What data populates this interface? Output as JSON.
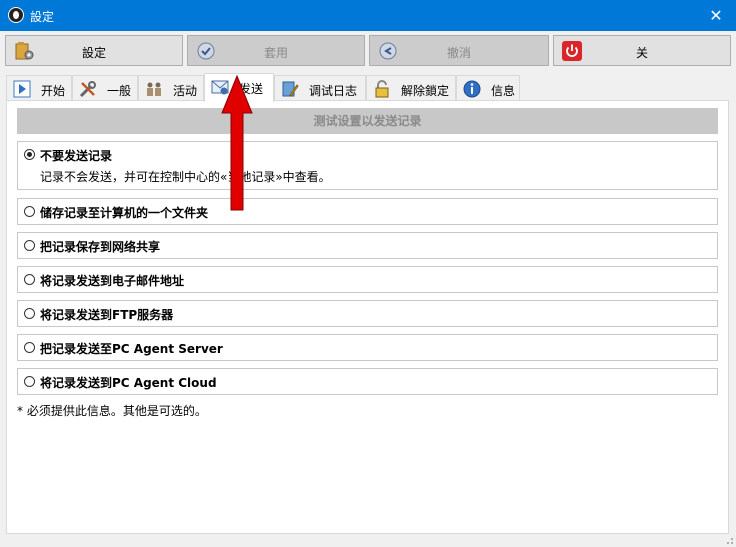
{
  "window": {
    "title": "設定",
    "close_glyph": "✕",
    "app_icon": "settings-app-icon"
  },
  "toolbar": {
    "settings_label": "設定",
    "apply_label": "套用",
    "cancel_label": "撤消",
    "close_label": "关"
  },
  "tabs": [
    {
      "label": "开始",
      "icon": "play-icon"
    },
    {
      "label": "一般",
      "icon": "tools-icon"
    },
    {
      "label": "活动",
      "icon": "people-icon"
    },
    {
      "label": "发送",
      "icon": "mail-icon",
      "active": true
    },
    {
      "label": "调试日志",
      "icon": "notepad-pencil-icon"
    },
    {
      "label": "解除鎖定",
      "icon": "lock-icon"
    },
    {
      "label": "信息",
      "icon": "info-icon"
    }
  ],
  "panel": {
    "header": "测试设置以发送记录",
    "options": [
      {
        "label": "不要发送记录",
        "description": "记录不会发送，并可在控制中心的«当地记录»中查看。",
        "checked": true
      },
      {
        "label": "储存记录至计算机的一个文件夹",
        "checked": false
      },
      {
        "label": "把记录保存到网络共享",
        "checked": false
      },
      {
        "label": "将记录发送到电子邮件地址",
        "checked": false
      },
      {
        "label": "将记录发送到FTP服务器",
        "checked": false
      },
      {
        "label": "把记录发送至PC Agent Server",
        "checked": false
      },
      {
        "label": "将记录发送到PC Agent Cloud",
        "checked": false
      }
    ],
    "footnote": "* 必须提供此信息。其他是可选的。"
  },
  "colors": {
    "titlebar": "#0078d7",
    "arrow": "#e00000",
    "disabled_button": "#cccccc"
  }
}
